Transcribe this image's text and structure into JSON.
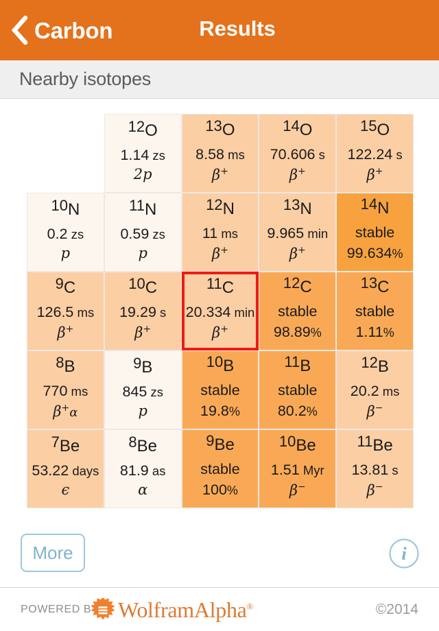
{
  "navbar": {
    "back_label": "Carbon",
    "title": "Results",
    "back_icon": "chevron-left-icon",
    "bg_color": "#E4711B"
  },
  "section": {
    "title": "Nearby isotopes"
  },
  "grid": {
    "highlight_color": "#EC1C15",
    "colors": {
      "lightest": "#FDF6EF",
      "light": "#FBDCBE",
      "medium": "#FBCEA4",
      "dark": "#F9A956",
      "darkest": "#F7A23F"
    },
    "rows": [
      {
        "element": "O",
        "offset": 1,
        "cells": [
          {
            "mass": "12",
            "symbol": "O",
            "halflife": "1.14",
            "unit": "zs",
            "decay": "2p",
            "shade": "lightest",
            "highlight": false
          },
          {
            "mass": "13",
            "symbol": "O",
            "halflife": "8.58",
            "unit": "ms",
            "decay": "β",
            "decay_sup": "+",
            "shade": "medium",
            "highlight": false
          },
          {
            "mass": "14",
            "symbol": "O",
            "halflife": "70.606",
            "unit": "s",
            "decay": "β",
            "decay_sup": "+",
            "shade": "medium",
            "highlight": false
          },
          {
            "mass": "15",
            "symbol": "O",
            "halflife": "122.24",
            "unit": "s",
            "decay": "β",
            "decay_sup": "+",
            "shade": "medium",
            "highlight": false
          }
        ]
      },
      {
        "element": "N",
        "offset": 0,
        "cells": [
          {
            "mass": "10",
            "symbol": "N",
            "halflife": "0.2",
            "unit": "zs",
            "decay": "p",
            "shade": "lightest",
            "highlight": false
          },
          {
            "mass": "11",
            "symbol": "N",
            "halflife": "0.59",
            "unit": "zs",
            "decay": "p",
            "shade": "lightest",
            "highlight": false
          },
          {
            "mass": "12",
            "symbol": "N",
            "halflife": "11",
            "unit": "ms",
            "decay": "β",
            "decay_sup": "+",
            "shade": "medium",
            "highlight": false
          },
          {
            "mass": "13",
            "symbol": "N",
            "halflife": "9.965",
            "unit": "min",
            "decay": "β",
            "decay_sup": "+",
            "shade": "medium",
            "highlight": false
          },
          {
            "mass": "14",
            "symbol": "N",
            "halflife": "stable",
            "unit": "",
            "abundance": "99.634",
            "shade": "darkest",
            "highlight": false
          }
        ]
      },
      {
        "element": "C",
        "offset": 0,
        "cells": [
          {
            "mass": "9",
            "symbol": "C",
            "halflife": "126.5",
            "unit": "ms",
            "decay": "β",
            "decay_sup": "+",
            "shade": "medium",
            "highlight": false
          },
          {
            "mass": "10",
            "symbol": "C",
            "halflife": "19.29",
            "unit": "s",
            "decay": "β",
            "decay_sup": "+",
            "shade": "medium",
            "highlight": false
          },
          {
            "mass": "11",
            "symbol": "C",
            "halflife": "20.334",
            "unit": "min",
            "decay": "β",
            "decay_sup": "+",
            "shade": "medium",
            "highlight": true
          },
          {
            "mass": "12",
            "symbol": "C",
            "halflife": "stable",
            "unit": "",
            "abundance": "98.89",
            "shade": "dark",
            "highlight": false
          },
          {
            "mass": "13",
            "symbol": "C",
            "halflife": "stable",
            "unit": "",
            "abundance": "1.11",
            "shade": "dark",
            "highlight": false
          }
        ]
      },
      {
        "element": "B",
        "offset": 0,
        "cells": [
          {
            "mass": "8",
            "symbol": "B",
            "halflife": "770",
            "unit": "ms",
            "decay": "β",
            "decay_sup": "+",
            "decay_extra": "α",
            "shade": "medium",
            "highlight": false
          },
          {
            "mass": "9",
            "symbol": "B",
            "halflife": "845",
            "unit": "zs",
            "decay": "p",
            "shade": "lightest",
            "highlight": false
          },
          {
            "mass": "10",
            "symbol": "B",
            "halflife": "stable",
            "unit": "",
            "abundance": "19.8",
            "shade": "dark",
            "highlight": false
          },
          {
            "mass": "11",
            "symbol": "B",
            "halflife": "stable",
            "unit": "",
            "abundance": "80.2",
            "shade": "dark",
            "highlight": false
          },
          {
            "mass": "12",
            "symbol": "B",
            "halflife": "20.2",
            "unit": "ms",
            "decay": "β",
            "decay_sup": "−",
            "shade": "medium",
            "highlight": false
          }
        ]
      },
      {
        "element": "Be",
        "offset": 0,
        "cells": [
          {
            "mass": "7",
            "symbol": "Be",
            "halflife": "53.22",
            "unit": "days",
            "decay": "ϵ",
            "shade": "medium",
            "highlight": false
          },
          {
            "mass": "8",
            "symbol": "Be",
            "halflife": "81.9",
            "unit": "as",
            "decay": "α",
            "shade": "lightest",
            "highlight": false
          },
          {
            "mass": "9",
            "symbol": "Be",
            "halflife": "stable",
            "unit": "",
            "abundance": "100",
            "shade": "dark",
            "highlight": false
          },
          {
            "mass": "10",
            "symbol": "Be",
            "halflife": "1.51",
            "unit": "Myr",
            "decay": "β",
            "decay_sup": "−",
            "shade": "dark",
            "highlight": false
          },
          {
            "mass": "11",
            "symbol": "Be",
            "halflife": "13.81",
            "unit": "s",
            "decay": "β",
            "decay_sup": "−",
            "shade": "medium",
            "highlight": false
          }
        ]
      }
    ]
  },
  "footer": {
    "more_label": "More",
    "info_icon": "info-icon",
    "info_glyph": "i"
  },
  "branding": {
    "powered_by": "POWERED BY",
    "wordmark": "WolframAlpha",
    "registered": "®",
    "copyright": "©2014",
    "accent_color": "#DD7A33"
  }
}
